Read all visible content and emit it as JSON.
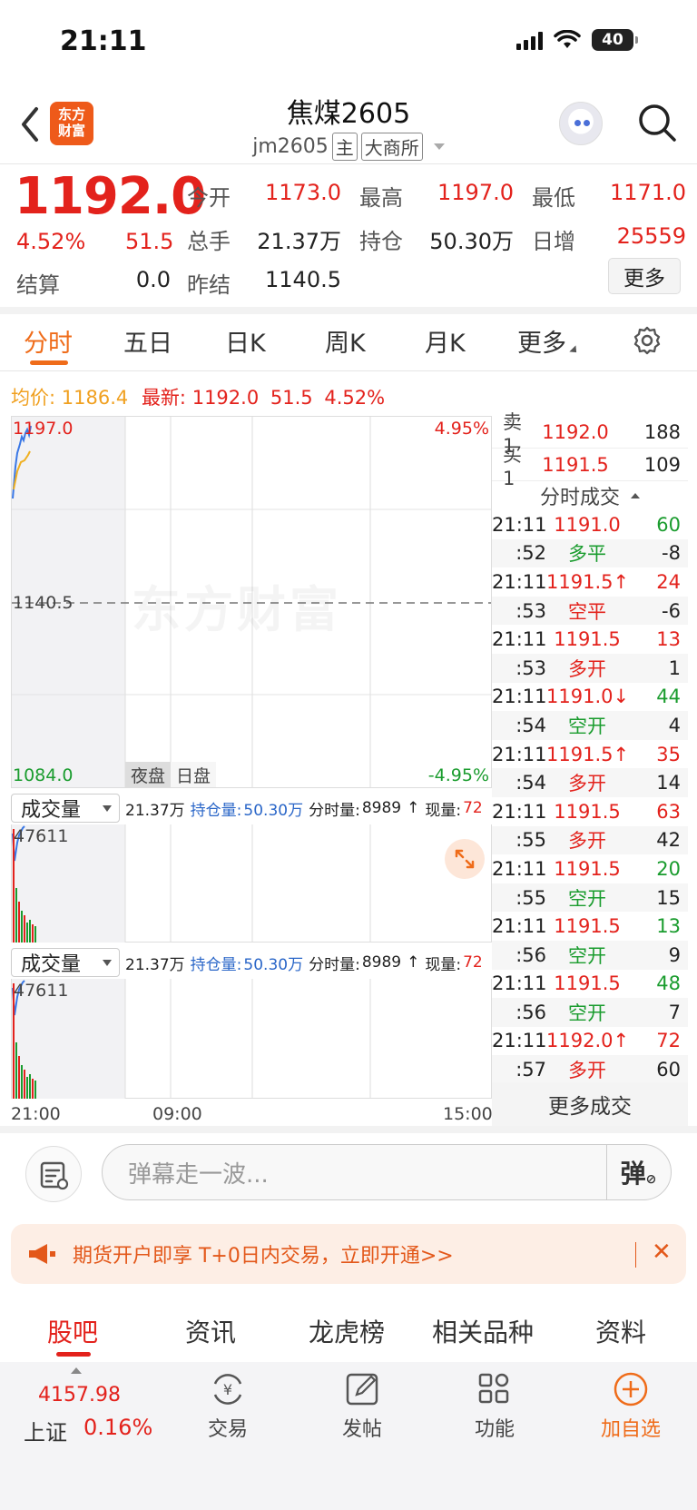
{
  "status": {
    "time": "21:11",
    "battery": "40"
  },
  "header": {
    "title": "焦煤2605",
    "code": "jm2605",
    "tag_main": "主",
    "tag_exchange": "大商所",
    "logo_line1": "东方",
    "logo_line2": "财富"
  },
  "quote": {
    "price": "1192.0",
    "change_pct": "4.52%",
    "change": "51.5",
    "settle_label": "结算",
    "settle": "0.0",
    "open_label": "今开",
    "open": "1173.0",
    "high_label": "最高",
    "high": "1197.0",
    "low_label": "最低",
    "low": "1171.0",
    "volume_label": "总手",
    "volume": "21.37万",
    "oi_label": "持仓",
    "oi": "50.30万",
    "daily_inc_label": "日增",
    "daily_inc": "25559",
    "prev_settle_label": "昨结",
    "prev_settle": "1140.5",
    "more_label": "更多"
  },
  "tabs": [
    "分时",
    "五日",
    "日K",
    "周K",
    "月K",
    "更多"
  ],
  "info": {
    "avg_label": "均价:",
    "avg": "1186.4",
    "latest_label": "最新:",
    "latest": "1192.0",
    "change": "51.5",
    "change_pct": "4.52%"
  },
  "chart": {
    "y_top": "1197.0",
    "y_mid": "1140.5",
    "y_bottom": "1084.0",
    "pct_top": "4.95%",
    "pct_bottom": "-4.95%",
    "session_night": "夜盘",
    "session_day": "日盘",
    "watermark": "东方财富",
    "x_labels": [
      "21:00",
      "09:00",
      "15:00"
    ],
    "vol_max": "47611"
  },
  "volbar": {
    "selector": "成交量",
    "total": "21.37万",
    "oi_label": "持仓量:",
    "oi": "50.30万",
    "tick_label": "分时量:",
    "tick": "8989",
    "now_label": "现量:",
    "now": "72"
  },
  "book": {
    "ask_label": "卖1",
    "ask_price": "1192.0",
    "ask_vol": "188",
    "bid_label": "买1",
    "bid_price": "1191.5",
    "bid_vol": "109",
    "trades_header": "分时成交"
  },
  "trades": [
    {
      "time": "21:11",
      "price": "1191.0",
      "vol": "60",
      "pc": "red",
      "vc": "green"
    },
    {
      "time": ":52",
      "price": "多平",
      "vol": "-8",
      "pc": "green",
      "vc": "dark"
    },
    {
      "time": "21:11",
      "price": "1191.5↑",
      "vol": "24",
      "pc": "red",
      "vc": "red"
    },
    {
      "time": ":53",
      "price": "空平",
      "vol": "-6",
      "pc": "red",
      "vc": "dark"
    },
    {
      "time": "21:11",
      "price": "1191.5",
      "vol": "13",
      "pc": "red",
      "vc": "red"
    },
    {
      "time": ":53",
      "price": "多开",
      "vol": "1",
      "pc": "red",
      "vc": "dark"
    },
    {
      "time": "21:11",
      "price": "1191.0↓",
      "vol": "44",
      "pc": "red",
      "vc": "green"
    },
    {
      "time": ":54",
      "price": "空开",
      "vol": "4",
      "pc": "green",
      "vc": "dark"
    },
    {
      "time": "21:11",
      "price": "1191.5↑",
      "vol": "35",
      "pc": "red",
      "vc": "red"
    },
    {
      "time": ":54",
      "price": "多开",
      "vol": "14",
      "pc": "red",
      "vc": "dark"
    },
    {
      "time": "21:11",
      "price": "1191.5",
      "vol": "63",
      "pc": "red",
      "vc": "red"
    },
    {
      "time": ":55",
      "price": "多开",
      "vol": "42",
      "pc": "red",
      "vc": "dark"
    },
    {
      "time": "21:11",
      "price": "1191.5",
      "vol": "20",
      "pc": "red",
      "vc": "green"
    },
    {
      "time": ":55",
      "price": "空开",
      "vol": "15",
      "pc": "green",
      "vc": "dark"
    },
    {
      "time": "21:11",
      "price": "1191.5",
      "vol": "13",
      "pc": "red",
      "vc": "green"
    },
    {
      "time": ":56",
      "price": "空开",
      "vol": "9",
      "pc": "green",
      "vc": "dark"
    },
    {
      "time": "21:11",
      "price": "1191.5",
      "vol": "48",
      "pc": "red",
      "vc": "green"
    },
    {
      "time": ":56",
      "price": "空开",
      "vol": "7",
      "pc": "green",
      "vc": "dark"
    },
    {
      "time": "21:11",
      "price": "1192.0↑",
      "vol": "72",
      "pc": "red",
      "vc": "red"
    },
    {
      "time": ":57",
      "price": "多开",
      "vol": "60",
      "pc": "red",
      "vc": "dark"
    }
  ],
  "more_trades": "更多成交",
  "comment": {
    "placeholder": "弹幕走一波...",
    "danmu": "弹"
  },
  "banner": {
    "text": "期货开户即享 T+0日内交易，立即开通>>"
  },
  "bottom_tabs": [
    "股吧",
    "资讯",
    "龙虎榜",
    "相关品种",
    "资料"
  ],
  "index": {
    "value": "4157.98",
    "name": "上证",
    "pct": "0.16%"
  },
  "nav": [
    "交易",
    "发帖",
    "功能",
    "加自选"
  ],
  "colors": {
    "up": "#e3221c",
    "down": "#1a9c2e",
    "accent": "#ef6c1a"
  }
}
